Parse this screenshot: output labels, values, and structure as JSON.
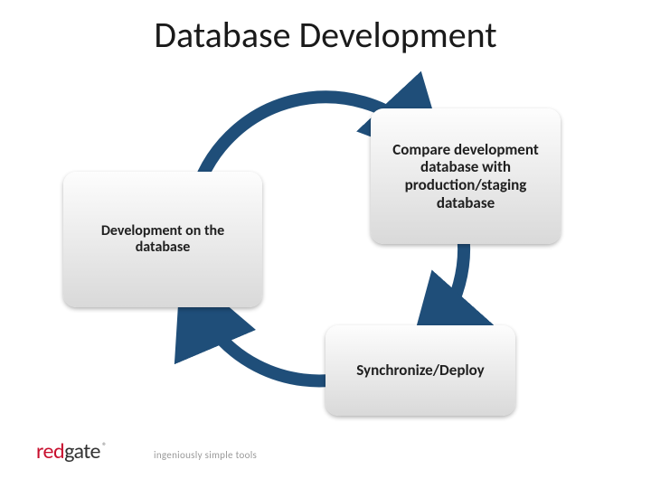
{
  "title": "Database Development",
  "cycle": {
    "left": "Development on the database",
    "topRight": "Compare development database with production/staging database",
    "bottomRight": "Synchronize/Deploy"
  },
  "colors": {
    "arrow": "#1f4e79"
  },
  "logo": {
    "name_part1": "red",
    "name_part2": "gate",
    "reg": "®",
    "tagline": "ingeniously simple tools"
  }
}
